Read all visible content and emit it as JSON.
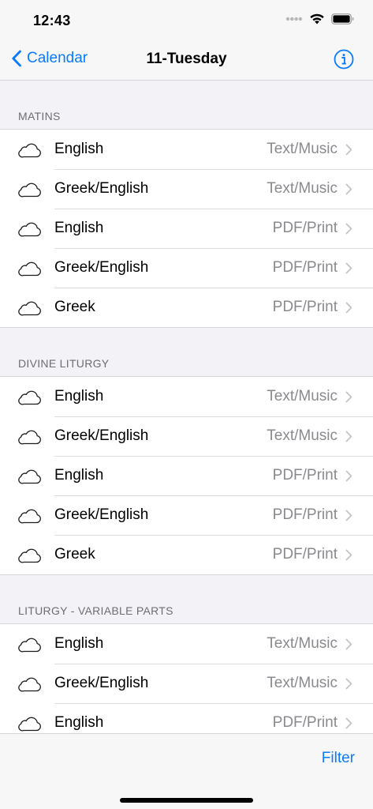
{
  "status_bar": {
    "time": "12:43"
  },
  "nav": {
    "back_label": "Calendar",
    "title": "11-Tuesday"
  },
  "sections": [
    {
      "header": "MATINS",
      "rows": [
        {
          "label": "English",
          "detail": "Text/Music"
        },
        {
          "label": "Greek/English",
          "detail": "Text/Music"
        },
        {
          "label": "English",
          "detail": "PDF/Print"
        },
        {
          "label": "Greek/English",
          "detail": "PDF/Print"
        },
        {
          "label": "Greek",
          "detail": "PDF/Print"
        }
      ]
    },
    {
      "header": "DIVINE LITURGY",
      "rows": [
        {
          "label": "English",
          "detail": "Text/Music"
        },
        {
          "label": "Greek/English",
          "detail": "Text/Music"
        },
        {
          "label": "English",
          "detail": "PDF/Print"
        },
        {
          "label": "Greek/English",
          "detail": "PDF/Print"
        },
        {
          "label": "Greek",
          "detail": "PDF/Print"
        }
      ]
    },
    {
      "header": "LITURGY - VARIABLE PARTS",
      "rows": [
        {
          "label": "English",
          "detail": "Text/Music"
        },
        {
          "label": "Greek/English",
          "detail": "Text/Music"
        },
        {
          "label": "English",
          "detail": "PDF/Print"
        }
      ]
    }
  ],
  "toolbar": {
    "filter_label": "Filter"
  },
  "colors": {
    "accent": "#0a7aff",
    "detail": "#8a8a8e",
    "background": "#f2f2f7"
  },
  "icons": {
    "row": "cloud-icon",
    "disclosure": "chevron-right-icon",
    "info": "info-circle-icon",
    "back": "chevron-left-icon"
  }
}
